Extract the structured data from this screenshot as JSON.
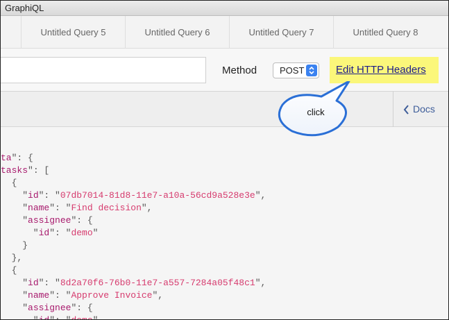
{
  "window": {
    "title": "GraphiQL"
  },
  "tabs": [
    {
      "label": "Untitled Query 5"
    },
    {
      "label": "Untitled Query 6"
    },
    {
      "label": "Untitled Query 7"
    },
    {
      "label": "Untitled Query 8"
    }
  ],
  "toolbar": {
    "url_value": "",
    "method_label": "Method",
    "method_value": "POST",
    "headers_button_label": "Edit HTTP Headers"
  },
  "docs": {
    "label": "Docs"
  },
  "callout": {
    "text": "click"
  },
  "colors": {
    "highlight": "#fbf77a",
    "key": "#a7196c",
    "string": "#d63b6e",
    "link": "#1c1c8a"
  },
  "result": {
    "data_key": "ta",
    "tasks_key": "tasks",
    "items": [
      {
        "id": "07db7014-81d8-11e7-a10a-56cd9a528e3e",
        "name": "Find decision",
        "assignee_id": "demo"
      },
      {
        "id": "8d2a70f6-76b0-11e7-a557-7284a05f48c1",
        "name": "Approve Invoice",
        "assignee_id": "demo"
      }
    ],
    "labels": {
      "id": "id",
      "name": "name",
      "assignee": "assignee"
    }
  }
}
